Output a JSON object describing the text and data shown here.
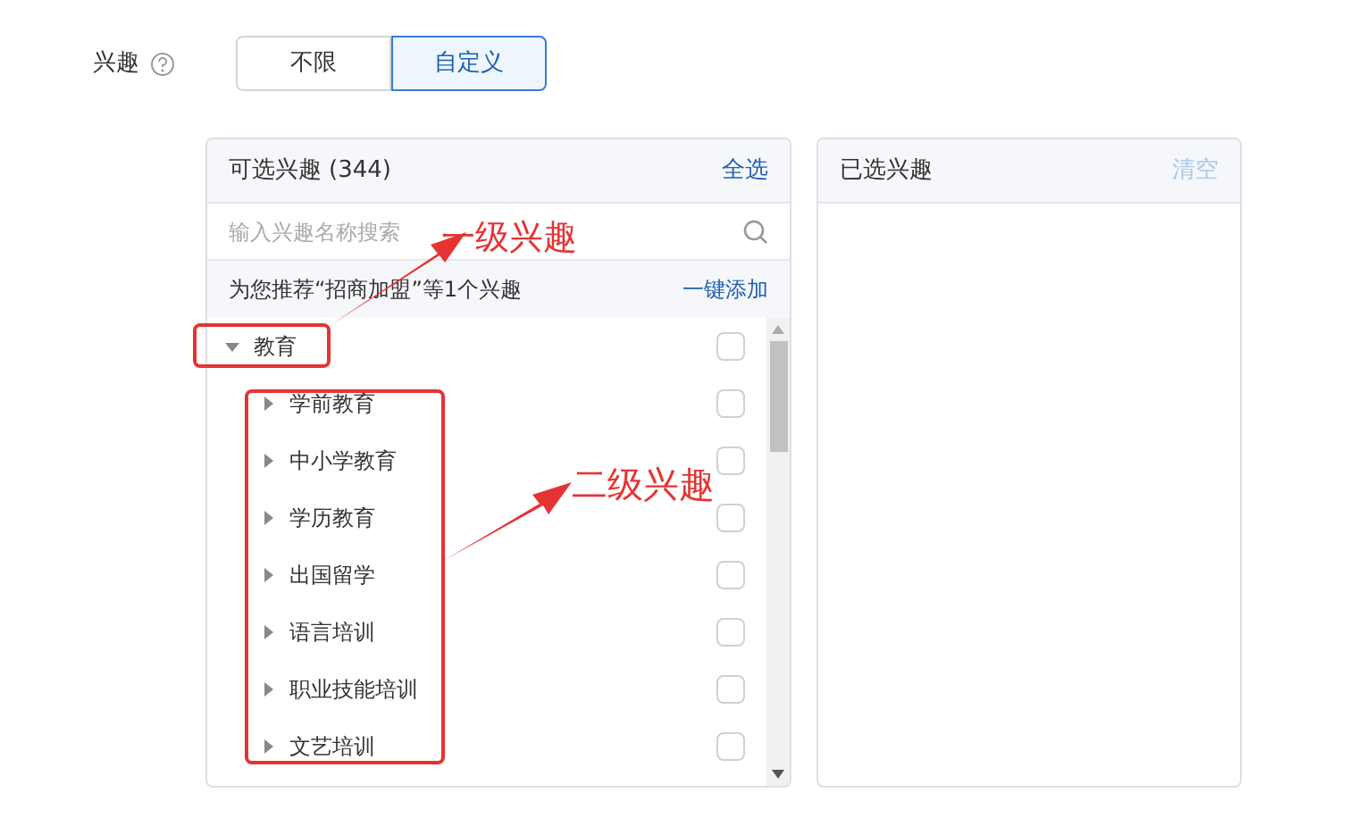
{
  "field": {
    "label": "兴趣",
    "options": [
      {
        "label": "不限",
        "selected": false
      },
      {
        "label": "自定义",
        "selected": true
      }
    ]
  },
  "available": {
    "title": "可选兴趣",
    "count": "(344)",
    "select_all": "全选",
    "search": {
      "placeholder": "输入兴趣名称搜索"
    },
    "recommend": {
      "text": "为您推荐“招商加盟”等1个兴趣",
      "action": "一键添加"
    },
    "tree": [
      {
        "label": "教育",
        "expanded": true,
        "checked": false,
        "children": [
          {
            "label": "学前教育",
            "expanded": false,
            "checked": false
          },
          {
            "label": "中小学教育",
            "expanded": false,
            "checked": false
          },
          {
            "label": "学历教育",
            "expanded": false,
            "checked": false
          },
          {
            "label": "出国留学",
            "expanded": false,
            "checked": false
          },
          {
            "label": "语言培训",
            "expanded": false,
            "checked": false
          },
          {
            "label": "职业技能培训",
            "expanded": false,
            "checked": false
          },
          {
            "label": "文艺培训",
            "expanded": false,
            "checked": false
          }
        ]
      }
    ]
  },
  "selected_panel": {
    "title": "已选兴趣",
    "clear": {
      "label": "清空",
      "disabled": true
    }
  },
  "annotations": [
    {
      "text": "一级兴趣"
    },
    {
      "text": "二级兴趣"
    }
  ]
}
